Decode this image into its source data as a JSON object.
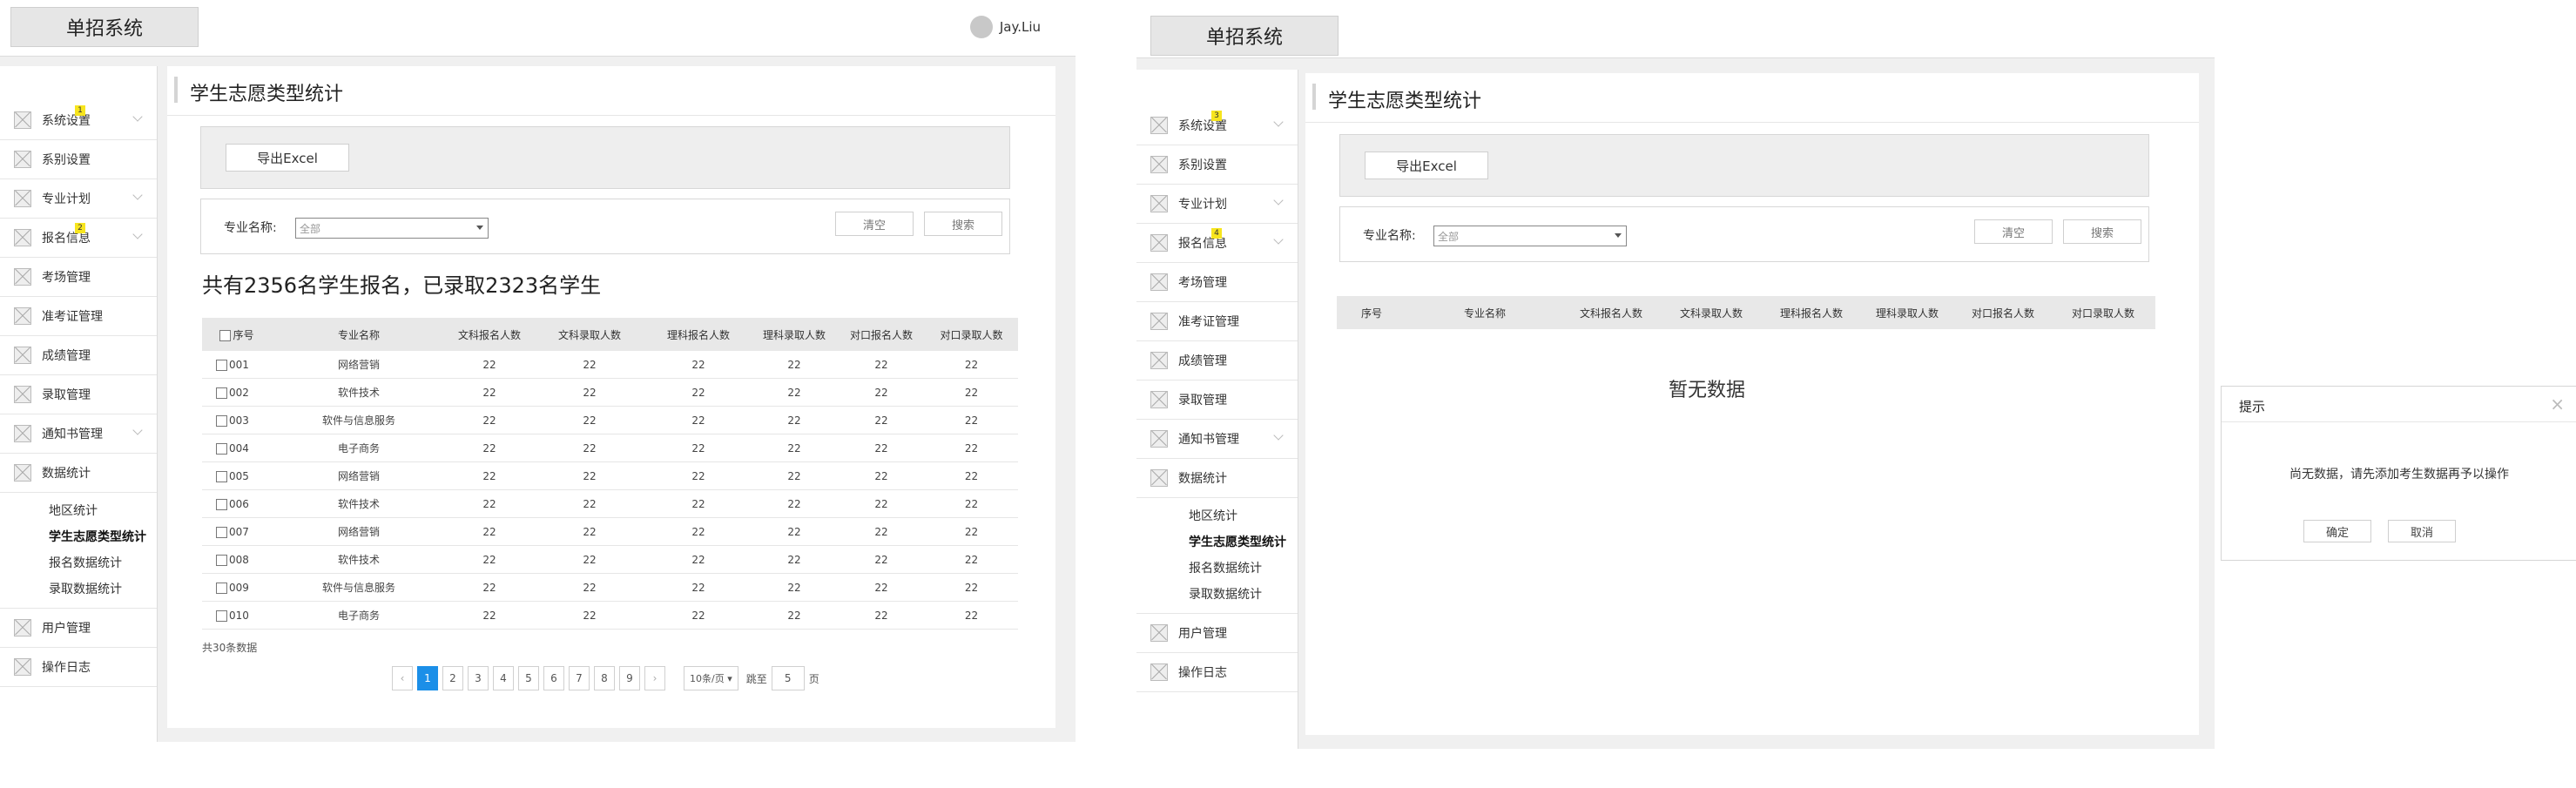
{
  "app": {
    "title": "单招系统",
    "user_name": "Jay.Liu"
  },
  "menu": {
    "items": [
      {
        "label": "系统设置",
        "badge": "1"
      },
      {
        "label": "系别设置"
      },
      {
        "label": "专业计划"
      },
      {
        "label": "报名信息",
        "badge": "2"
      },
      {
        "label": "考场管理"
      },
      {
        "label": "准考证管理"
      },
      {
        "label": "成绩管理"
      },
      {
        "label": "录取管理"
      },
      {
        "label": "通知书管理"
      },
      {
        "label": "数据统计"
      }
    ],
    "sub_items": [
      "地区统计",
      "学生志愿类型统计",
      "报名数据统计",
      "录取数据统计"
    ],
    "bottom_items": [
      "用户管理",
      "操作日志"
    ]
  },
  "menu2": {
    "items": [
      {
        "label": "系统设置",
        "badge": "3"
      },
      {
        "label": "系别设置"
      },
      {
        "label": "专业计划"
      },
      {
        "label": "报名信息",
        "badge": "4"
      },
      {
        "label": "考场管理"
      },
      {
        "label": "准考证管理"
      },
      {
        "label": "成绩管理"
      },
      {
        "label": "录取管理"
      },
      {
        "label": "通知书管理"
      },
      {
        "label": "数据统计"
      }
    ]
  },
  "page": {
    "title": "学生志愿类型统计",
    "export_label": "导出Excel",
    "filter_label": "专业名称:",
    "select_value": "全部",
    "clear_label": "清空",
    "search_label": "搜索",
    "summary": "共有2356名学生报名，已录取2323名学生"
  },
  "table": {
    "headers": [
      "序号",
      "专业名称",
      "文科报名人数",
      "文科录取人数",
      "理科报名人数",
      "理科录取人数",
      "对口报名人数",
      "对口录取人数"
    ],
    "rows": [
      [
        "001",
        "网络营销",
        "22",
        "22",
        "22",
        "22",
        "22",
        "22"
      ],
      [
        "002",
        "软件技术",
        "22",
        "22",
        "22",
        "22",
        "22",
        "22"
      ],
      [
        "003",
        "软件与信息服务",
        "22",
        "22",
        "22",
        "22",
        "22",
        "22"
      ],
      [
        "004",
        "电子商务",
        "22",
        "22",
        "22",
        "22",
        "22",
        "22"
      ],
      [
        "005",
        "网络营销",
        "22",
        "22",
        "22",
        "22",
        "22",
        "22"
      ],
      [
        "006",
        "软件技术",
        "22",
        "22",
        "22",
        "22",
        "22",
        "22"
      ],
      [
        "007",
        "网络营销",
        "22",
        "22",
        "22",
        "22",
        "22",
        "22"
      ],
      [
        "008",
        "软件技术",
        "22",
        "22",
        "22",
        "22",
        "22",
        "22"
      ],
      [
        "009",
        "软件与信息服务",
        "22",
        "22",
        "22",
        "22",
        "22",
        "22"
      ],
      [
        "010",
        "电子商务",
        "22",
        "22",
        "22",
        "22",
        "22",
        "22"
      ]
    ]
  },
  "pagination": {
    "total_text": "共30条数据",
    "prev": "‹",
    "next": "›",
    "pages": [
      "1",
      "2",
      "3",
      "4",
      "5",
      "6",
      "7",
      "8",
      "9"
    ],
    "current": "1",
    "page_size": "10条/页",
    "jump_label": "跳至",
    "jump_value": "5",
    "page_unit": "页"
  },
  "empty_state": {
    "text": "暂无数据"
  },
  "dialog": {
    "title": "提示",
    "close": "×",
    "message": "尚无数据，请先添加考生数据再予以操作",
    "ok_label": "确定",
    "cancel_label": "取消"
  },
  "colors": {
    "accent": "#1b8fe8",
    "badge": "#f7e51e",
    "page_bg": "#f0f0f0"
  },
  "icons": {
    "menu_placeholder": "image-placeholder-icon",
    "expand": "chevron-down-icon",
    "avatar": "avatar",
    "close": "close-icon",
    "caret": "caret-down-icon"
  }
}
